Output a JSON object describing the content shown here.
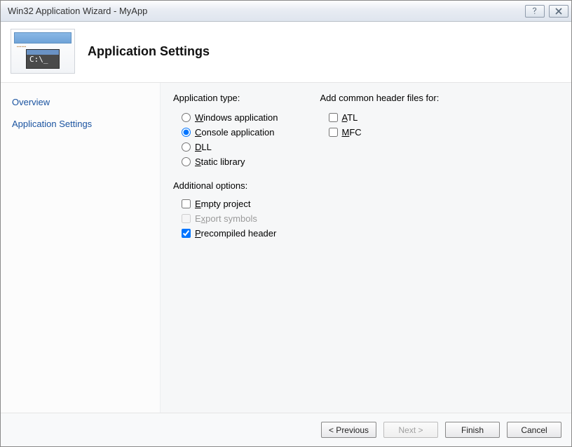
{
  "window": {
    "title": "Win32 Application Wizard - MyApp"
  },
  "header": {
    "title": "Application Settings",
    "console_text": "C:\\_"
  },
  "sidebar": {
    "items": [
      {
        "label": "Overview",
        "active": false
      },
      {
        "label": "Application Settings",
        "active": true
      }
    ]
  },
  "content": {
    "app_type": {
      "label": "Application type:",
      "options": [
        {
          "label_pre": "",
          "u": "W",
          "label_post": "indows application",
          "checked": false
        },
        {
          "label_pre": "",
          "u": "C",
          "label_post": "onsole application",
          "checked": true
        },
        {
          "label_pre": "",
          "u": "D",
          "label_post": "LL",
          "checked": false
        },
        {
          "label_pre": "",
          "u": "S",
          "label_post": "tatic library",
          "checked": false
        }
      ]
    },
    "additional": {
      "label": "Additional options:",
      "options": [
        {
          "label_pre": "",
          "u": "E",
          "label_post": "mpty project",
          "checked": false,
          "disabled": false
        },
        {
          "label_pre": "E",
          "u": "x",
          "label_post": "port symbols",
          "checked": false,
          "disabled": true
        },
        {
          "label_pre": "",
          "u": "P",
          "label_post": "recompiled header",
          "checked": true,
          "disabled": false
        }
      ]
    },
    "headers": {
      "label": "Add common header files for:",
      "options": [
        {
          "label_pre": "",
          "u": "A",
          "label_post": "TL",
          "checked": false
        },
        {
          "label_pre": "",
          "u": "M",
          "label_post": "FC",
          "checked": false
        }
      ]
    }
  },
  "footer": {
    "previous": "< Previous",
    "next": "Next >",
    "finish": "Finish",
    "cancel": "Cancel"
  }
}
